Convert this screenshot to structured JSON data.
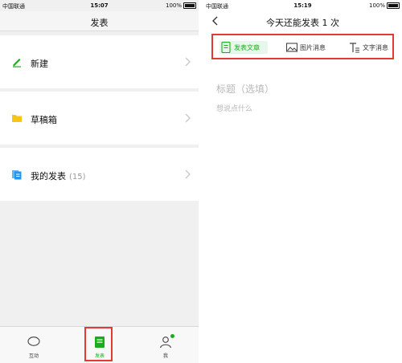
{
  "left": {
    "status": {
      "carrier": "中国联通",
      "time": "15:07",
      "battery": "100%"
    },
    "title": "发表",
    "menu": [
      {
        "label": "新建",
        "icon": "pencil-icon"
      },
      {
        "label": "草稿箱",
        "icon": "folder-icon"
      },
      {
        "label": "我的发表",
        "count": "(15)",
        "icon": "documents-icon"
      }
    ],
    "tabs": [
      {
        "label": "互动",
        "icon": "chat-bubble-icon"
      },
      {
        "label": "发表",
        "icon": "publish-icon"
      },
      {
        "label": "我",
        "icon": "person-icon"
      }
    ]
  },
  "right": {
    "status": {
      "carrier": "中国联通",
      "time": "15:19",
      "battery": "100%"
    },
    "title": "今天还能发表 1 次",
    "tools": [
      {
        "label": "发表文章",
        "icon": "article-icon"
      },
      {
        "label": "图片消息",
        "icon": "image-icon"
      },
      {
        "label": "文字消息",
        "icon": "text-icon"
      }
    ],
    "title_placeholder": "标题（选填）",
    "body_placeholder": "想说点什么"
  },
  "colors": {
    "accent": "#1aad19",
    "highlight": "#e53935",
    "folder": "#f5c518",
    "docs": "#2196f3"
  }
}
